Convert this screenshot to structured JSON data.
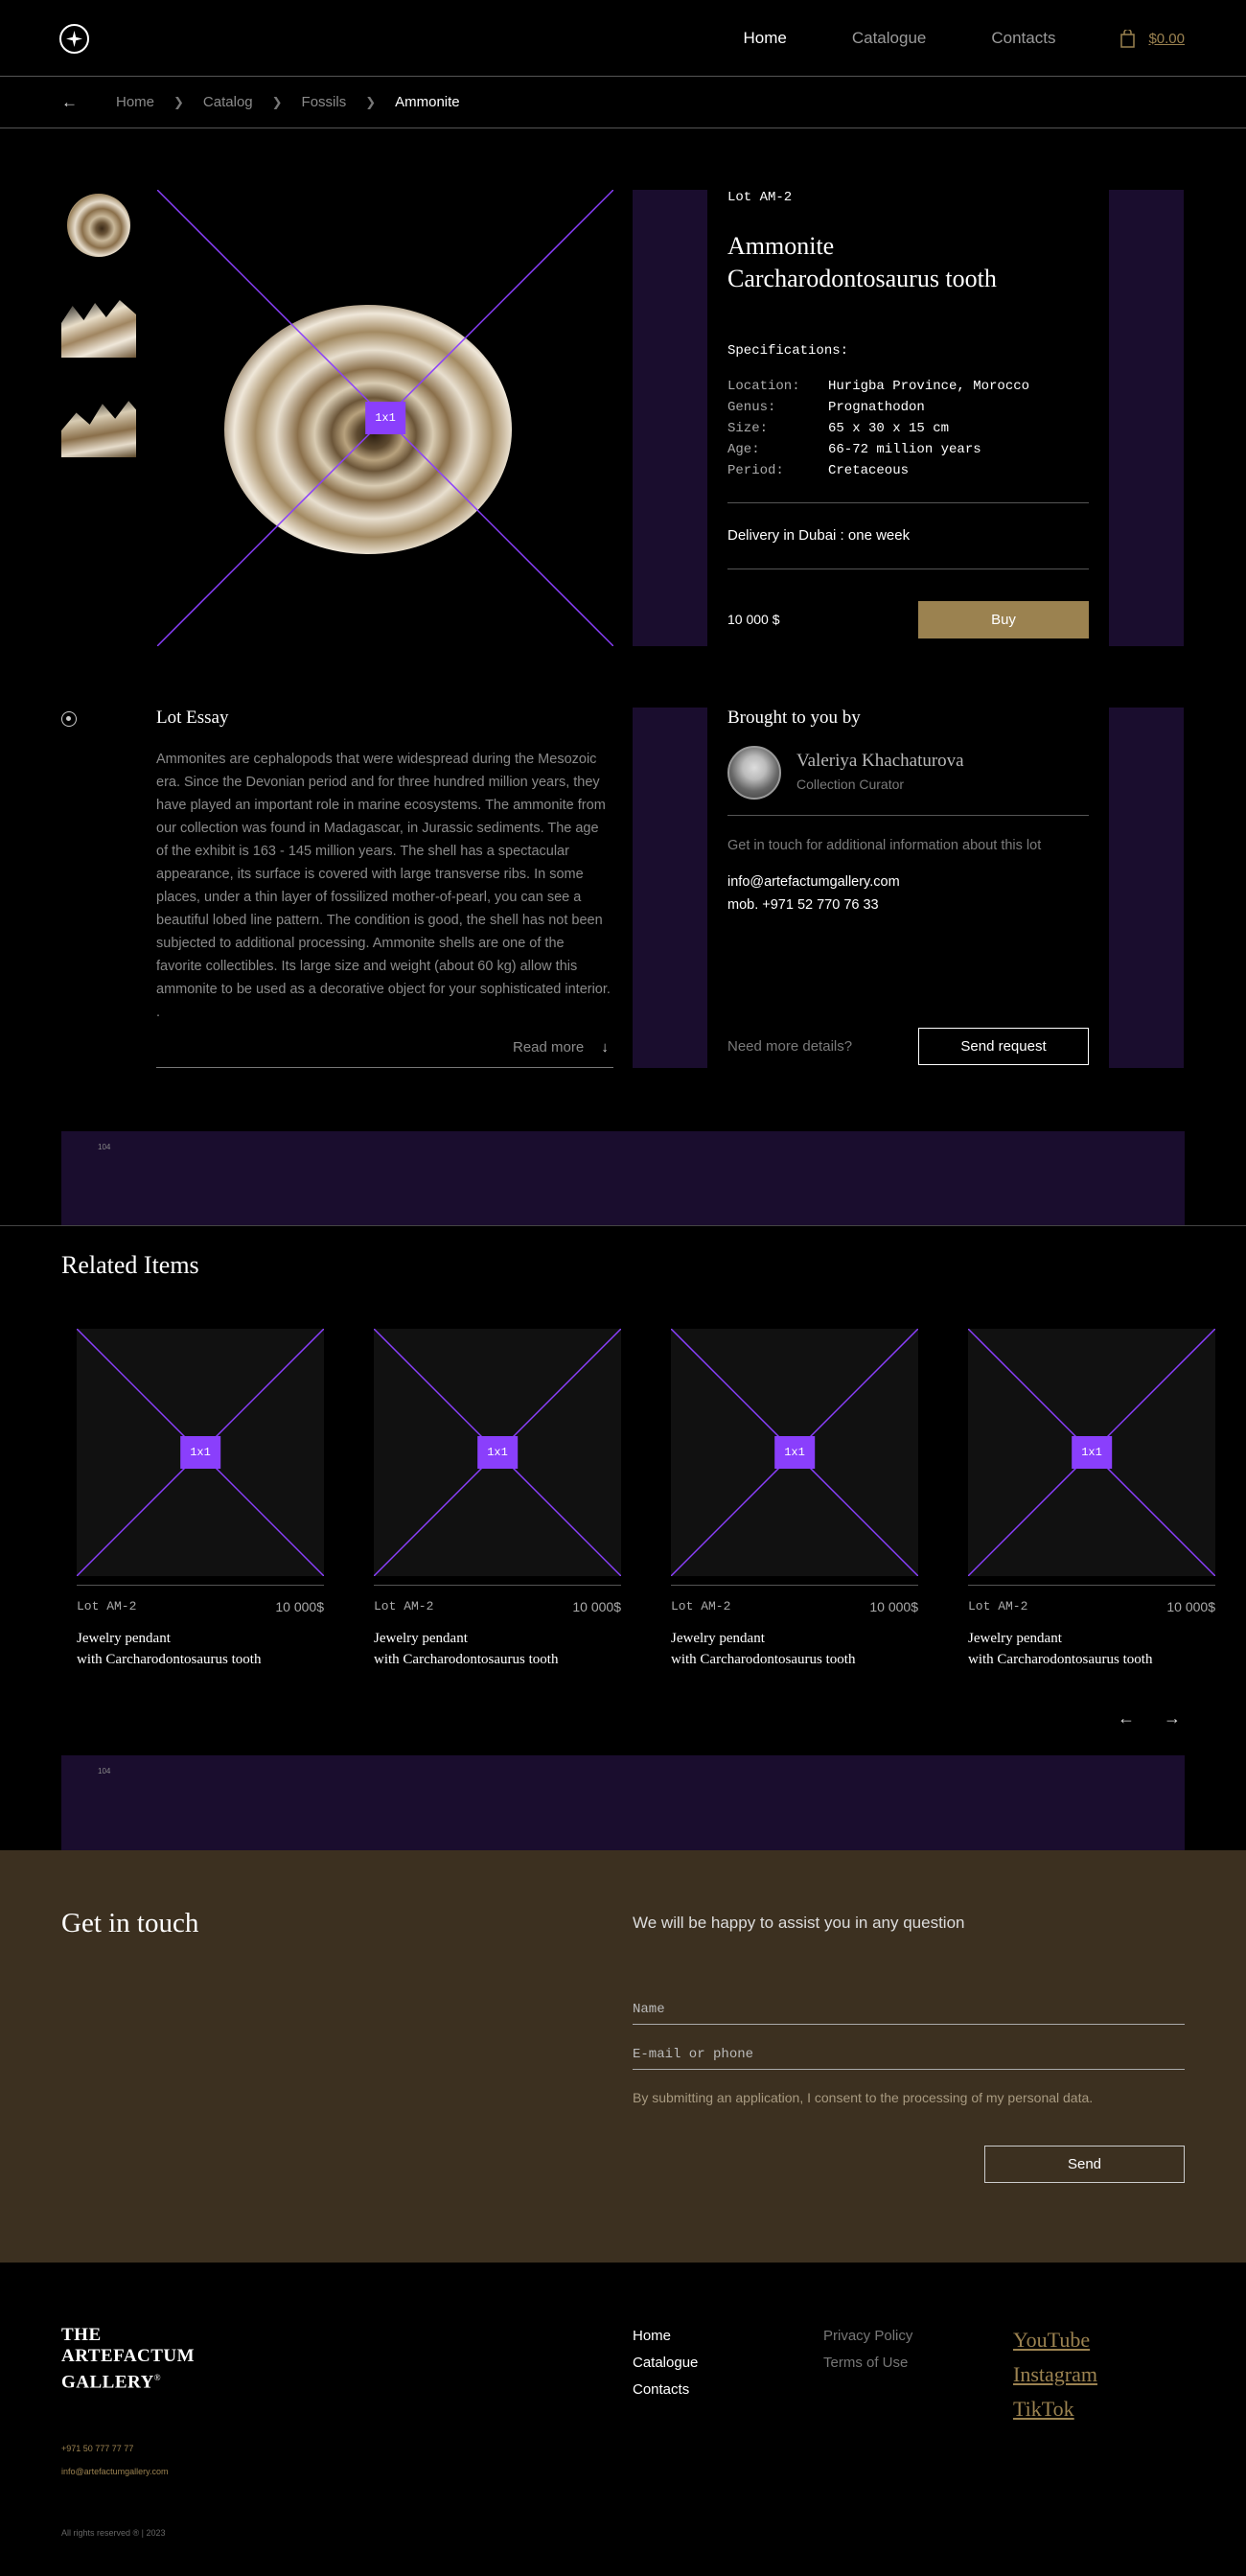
{
  "header": {
    "nav": [
      {
        "label": "Home",
        "active": true
      },
      {
        "label": "Catalogue",
        "active": false
      },
      {
        "label": "Contacts",
        "active": false
      }
    ],
    "cart_total": "$0.00"
  },
  "breadcrumb": {
    "items": [
      "Home",
      "Catalog",
      "Fossils"
    ],
    "current": "Ammonite"
  },
  "product": {
    "placeholder_tag": "1x1",
    "lot": "Lot AM-2",
    "title_line1": "Ammonite",
    "title_line2": "Carcharodontosaurus tooth",
    "specs_heading": "Specifications:",
    "specs": [
      {
        "key": "Location:",
        "value": "Hurigba Province, Morocco"
      },
      {
        "key": "Genus:",
        "value": "Prognathodon"
      },
      {
        "key": "Size:",
        "value": "65 x 30 x 15 cm"
      },
      {
        "key": "Age:",
        "value": "66-72 million years"
      },
      {
        "key": "Period:",
        "value": "Cretaceous"
      }
    ],
    "delivery": "Delivery in Dubai : one week",
    "price": "10 000 $",
    "buy_label": "Buy"
  },
  "essay": {
    "title": "Lot Essay",
    "text": "Ammonites are cephalopods that were widespread during the Mesozoic era. Since the Devonian period and for three hundred million years, they have played an important role in marine ecosystems. The ammonite from our collection was found in Madagascar, in Jurassic sediments. The age of the exhibit is 163 - 145 million years. The shell has a spectacular appearance, its surface is covered with large transverse ribs. In some places, under a thin layer of fossilized mother-of-pearl, you can see a beautiful lobed line pattern. The condition is good, the shell has not been subjected to additional processing. Ammonite shells are one of the favorite collectibles. Its large size and weight (about 60 kg) allow this ammonite to be used as a decorative object for your sophisticated interior. .",
    "read_more": "Read more"
  },
  "curator": {
    "heading": "Brought to you by",
    "name": "Valeriya Khachaturova",
    "role": "Collection Curator",
    "note": "Get in touch for additional information about this lot",
    "email": "info@artefactumgallery.com",
    "mobile": "mob. +971 52 770 76 33",
    "need_more": "Need more details?",
    "send_request": "Send request"
  },
  "strip_label": "104",
  "related": {
    "title": "Related Items",
    "items": [
      {
        "lot": "Lot AM-2",
        "price": "10 000$",
        "name_line1": "Jewelry pendant",
        "name_line2": "with Carcharodontosaurus tooth"
      },
      {
        "lot": "Lot AM-2",
        "price": "10 000$",
        "name_line1": "Jewelry pendant",
        "name_line2": "with Carcharodontosaurus tooth"
      },
      {
        "lot": "Lot AM-2",
        "price": "10 000$",
        "name_line1": "Jewelry pendant",
        "name_line2": "with Carcharodontosaurus tooth"
      },
      {
        "lot": "Lot AM-2",
        "price": "10 000$",
        "name_line1": "Jewelry pendant",
        "name_line2": "with Carcharodontosaurus tooth"
      }
    ]
  },
  "contact_form": {
    "title": "Get in touch",
    "subtitle": "We will be happy to assist you in any question",
    "name_placeholder": "Name",
    "contact_placeholder": "E-mail or phone",
    "consent": "By submitting an application, I consent to the processing of my personal data.",
    "send_label": "Send"
  },
  "footer": {
    "logo_line1": "THE",
    "logo_line2": "ARTEFACTUM",
    "logo_line3": "GALLERY",
    "logo_mark": "®",
    "nav": [
      "Home",
      "Catalogue",
      "Contacts"
    ],
    "legal": [
      "Privacy Policy",
      "Terms of Use"
    ],
    "social": [
      "YouTube",
      "Instagram",
      "TikTok"
    ],
    "phone": "+971 50 777 77 77",
    "email": "info@artefactumgallery.com",
    "copyright": "All rights reserved ® | 2023"
  },
  "colors": {
    "accent_gold": "#9b8250",
    "placeholder_purple": "#8a3ffc",
    "panel_purple": "#1a0d2e",
    "touch_bg": "#3c3020"
  },
  "icons": [
    "logo-star-icon",
    "cart-icon",
    "back-arrow-icon",
    "chevron-right-icon",
    "essay-target-icon",
    "arrow-down-icon",
    "arrow-left-icon",
    "arrow-right-icon"
  ]
}
